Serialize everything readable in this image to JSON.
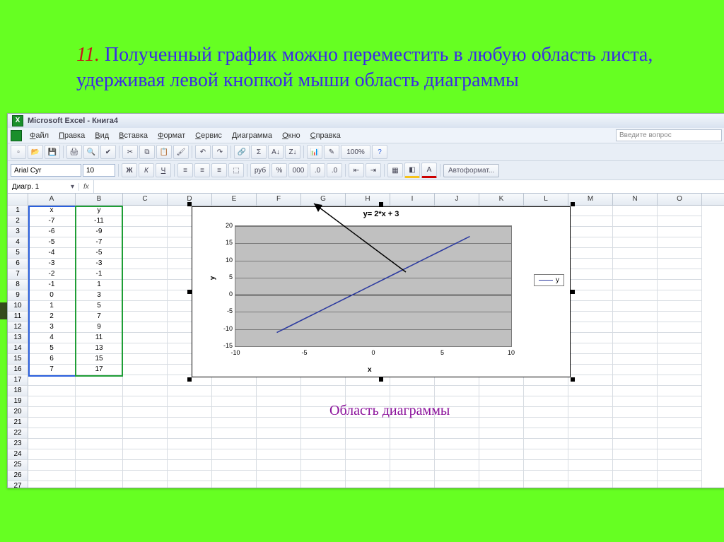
{
  "slide": {
    "num": "11.",
    "text": "Полученный график можно переместить в любую область листа, удерживая левой кнопкой мыши область диаграммы"
  },
  "window_title": "Microsoft Excel - Книга4",
  "menu": [
    "Файл",
    "Правка",
    "Вид",
    "Вставка",
    "Формат",
    "Сервис",
    "Диаграмма",
    "Окно",
    "Справка"
  ],
  "question_hint": "Введите вопрос",
  "font_name": "Arial Cyr",
  "font_size": "10",
  "autoformat": "Автоформат...",
  "name_box": "Диагр. 1",
  "fx": "fx",
  "columns": [
    "A",
    "B",
    "C",
    "D",
    "E",
    "F",
    "G",
    "H",
    "I",
    "J",
    "K",
    "L",
    "M",
    "N",
    "O"
  ],
  "rows": [
    [
      "x",
      "y"
    ],
    [
      "-7",
      "-11"
    ],
    [
      "-6",
      "-9"
    ],
    [
      "-5",
      "-7"
    ],
    [
      "-4",
      "-5"
    ],
    [
      "-3",
      "-3"
    ],
    [
      "-2",
      "-1"
    ],
    [
      "-1",
      "1"
    ],
    [
      "0",
      "3"
    ],
    [
      "1",
      "5"
    ],
    [
      "2",
      "7"
    ],
    [
      "3",
      "9"
    ],
    [
      "4",
      "11"
    ],
    [
      "5",
      "13"
    ],
    [
      "6",
      "15"
    ],
    [
      "7",
      "17"
    ]
  ],
  "chart_data": {
    "type": "line",
    "title": "y= 2*x + 3",
    "xlabel": "x",
    "ylabel": "y",
    "xlim": [
      -10,
      10
    ],
    "ylim": [
      -15,
      20
    ],
    "xticks": [
      -10,
      -5,
      0,
      5,
      10
    ],
    "yticks": [
      -15,
      -10,
      -5,
      0,
      5,
      10,
      15,
      20
    ],
    "series": [
      {
        "name": "y",
        "x": [
          -7,
          -6,
          -5,
          -4,
          -3,
          -2,
          -1,
          0,
          1,
          2,
          3,
          4,
          5,
          6,
          7
        ],
        "y": [
          -11,
          -9,
          -7,
          -5,
          -3,
          -1,
          1,
          3,
          5,
          7,
          9,
          11,
          13,
          15,
          17
        ]
      }
    ]
  },
  "caption": "Область диаграммы"
}
